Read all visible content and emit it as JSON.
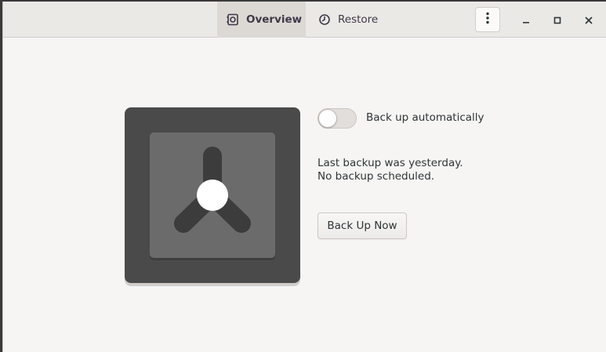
{
  "header": {
    "tabs": [
      {
        "label": "Overview",
        "icon": "overview-icon",
        "active": true
      },
      {
        "label": "Restore",
        "icon": "clock-icon",
        "active": false
      }
    ],
    "menu_icon": "vertical-dots-icon",
    "window_controls": [
      "minimize-icon",
      "maximize-icon",
      "close-icon"
    ]
  },
  "main": {
    "auto_backup": {
      "label": "Back up automatically",
      "enabled": false
    },
    "status_lines": [
      "Last backup was yesterday.",
      "No backup scheduled."
    ],
    "backup_button_label": "Back Up Now"
  },
  "colors": {
    "window_bg": "#f6f5f4",
    "header_bg": "#ebe9e6",
    "active_tab_bg": "#dcd9d5",
    "logo_outer": "#4a4a4a",
    "logo_inner": "#6b6b6b"
  }
}
